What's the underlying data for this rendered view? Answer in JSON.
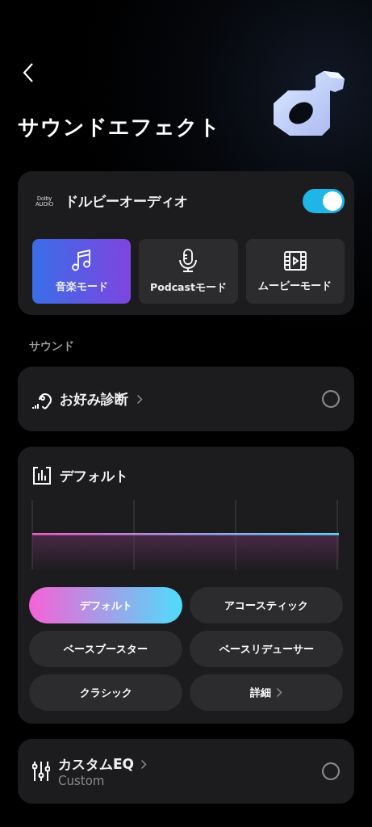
{
  "header": {
    "title": "サウンドエフェクト"
  },
  "dolby": {
    "logo_line_1": "Dolby",
    "logo_line_2": "AUDIO",
    "label": "ドルビーオーディオ",
    "on": true,
    "modes": [
      {
        "kind": "music",
        "label": "音楽モード",
        "selected": true
      },
      {
        "kind": "podcast",
        "label": "Podcastモード",
        "selected": false
      },
      {
        "kind": "movie",
        "label": "ムービーモード",
        "selected": false
      }
    ]
  },
  "section_label": "サウンド",
  "preference": {
    "label": "お好み診断",
    "selected": false
  },
  "presets": {
    "title": "デフォルト",
    "items": [
      {
        "kind": "preset",
        "label": "デフォルト",
        "selected": true
      },
      {
        "kind": "preset",
        "label": "アコースティック",
        "selected": false
      },
      {
        "kind": "preset",
        "label": "ベースブースター",
        "selected": false
      },
      {
        "kind": "preset",
        "label": "ベースリデューサー",
        "selected": false
      },
      {
        "kind": "preset",
        "label": "クラシック",
        "selected": false
      },
      {
        "kind": "more",
        "label": "詳細",
        "selected": false
      }
    ]
  },
  "custom_eq": {
    "label": "カスタムEQ",
    "sublabel": "Custom",
    "selected": false
  }
}
